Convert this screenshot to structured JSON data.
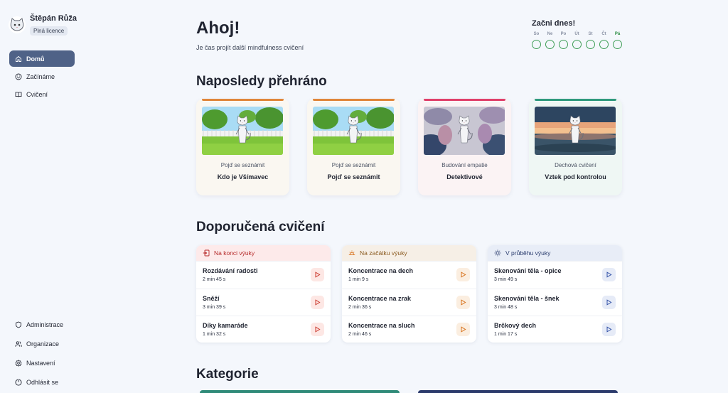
{
  "user": {
    "name": "Štěpán Růža",
    "license": "Plná licence"
  },
  "nav_top": [
    {
      "label": "Domů",
      "icon": "home-icon",
      "active": true
    },
    {
      "label": "Začínáme",
      "icon": "smile-icon",
      "active": false
    },
    {
      "label": "Cvičení",
      "icon": "book-icon",
      "active": false
    }
  ],
  "nav_bottom": [
    {
      "label": "Administrace",
      "icon": "shield-icon"
    },
    {
      "label": "Organizace",
      "icon": "users-icon"
    },
    {
      "label": "Nastavení",
      "icon": "gear-icon"
    },
    {
      "label": "Odhlásit se",
      "icon": "logout-icon"
    }
  ],
  "header": {
    "title": "Ahoj!",
    "subtitle": "Je čas projít další mindfulness cvičení"
  },
  "streak": {
    "title": "Začni dnes!",
    "days": [
      "So",
      "Ne",
      "Po",
      "Út",
      "St",
      "Čt",
      "Pá"
    ],
    "today_index": 6
  },
  "sections": {
    "recent": "Naposledy přehráno",
    "recommended": "Doporučená cvičení",
    "categories": "Kategorie"
  },
  "recent": [
    {
      "category": "Pojď se seznámit",
      "title": "Kdo je Všímavec",
      "accent": "#e0863a",
      "bg": "#faf7f1",
      "scene": "park"
    },
    {
      "category": "Pojď se seznámit",
      "title": "Pojď se seznámit",
      "accent": "#e0863a",
      "bg": "#faf7f1",
      "scene": "park"
    },
    {
      "category": "Budování empatie",
      "title": "Detektivové",
      "accent": "#e0406a",
      "bg": "#fbf3f4",
      "scene": "leaves"
    },
    {
      "category": "Dechová cvičení",
      "title": "Vztek pod kontrolou",
      "accent": "#2f9a7d",
      "bg": "#eff7f4",
      "scene": "sunset"
    }
  ],
  "recommended": [
    {
      "heading": "Na konci výuky",
      "icon": "exit-icon",
      "head_bg": "#fdeaea",
      "head_color": "#b62b2b",
      "play_bg": "#fde7e4",
      "play_color": "#cc3b2f",
      "items": [
        {
          "title": "Rozdávání radosti",
          "duration": "2 min 45 s"
        },
        {
          "title": "Sněží",
          "duration": "3 min 39 s"
        },
        {
          "title": "Díky kamaráde",
          "duration": "1 min 32 s"
        }
      ]
    },
    {
      "heading": "Na začátku výuky",
      "icon": "sunrise-icon",
      "head_bg": "#f6efe6",
      "head_color": "#8a5a1f",
      "play_bg": "#fbeee0",
      "play_color": "#d8741f",
      "items": [
        {
          "title": "Koncentrace na dech",
          "duration": "1 min 9 s"
        },
        {
          "title": "Koncentrace na zrak",
          "duration": "2 min 36 s"
        },
        {
          "title": "Koncentrace na sluch",
          "duration": "2 min 46 s"
        }
      ]
    },
    {
      "heading": "V průběhu výuky",
      "icon": "sun-icon",
      "head_bg": "#e8edf7",
      "head_color": "#2a3c6e",
      "play_bg": "#e6ebf7",
      "play_color": "#3453a8",
      "items": [
        {
          "title": "Skenování těla - opice",
          "duration": "3 min 49 s"
        },
        {
          "title": "Skenování těla - šnek",
          "duration": "3 min 48 s"
        },
        {
          "title": "Brčkový dech",
          "duration": "1 min 17 s"
        }
      ]
    }
  ],
  "category_strips": [
    "#2f8a78",
    "#2b3a6b"
  ]
}
